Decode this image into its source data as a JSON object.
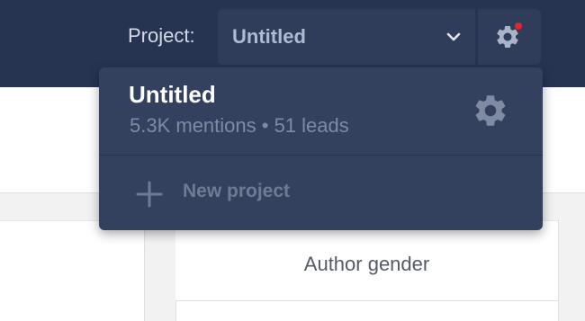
{
  "header": {
    "project_label": "Project:",
    "selected_project": "Untitled",
    "chevron_icon": "chevron-down-icon",
    "settings_icon": "gear-icon",
    "notification_dot_color": "#e8232b"
  },
  "dropdown": {
    "items": [
      {
        "name": "Untitled",
        "stats": "5.3K mentions • 51 leads",
        "icon": "gear-icon"
      }
    ],
    "new_project_label": "New project",
    "new_project_icon": "plus-icon"
  },
  "table": {
    "column_header": "Author gender"
  },
  "colors": {
    "header_bg": "#263452",
    "dropdown_bg": "#33415f",
    "accent_red": "#e8232b"
  }
}
